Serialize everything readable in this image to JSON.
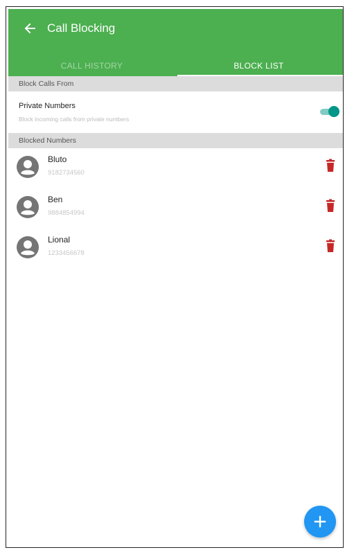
{
  "appbar": {
    "title": "Call Blocking",
    "back_icon": "arrow-left-icon",
    "color": "#4caf50"
  },
  "tabs": [
    {
      "label": "CALL HISTORY",
      "selected": false
    },
    {
      "label": "BLOCK LIST",
      "selected": true
    }
  ],
  "block_calls_from": {
    "header": "Block Calls From",
    "private_numbers": {
      "title": "Private Numbers",
      "subtitle": "Block incoming calls from private numbers",
      "enabled": true,
      "accent": "#009688"
    }
  },
  "blocked_numbers": {
    "header": "Blocked Numbers",
    "items": [
      {
        "name": "Bluto",
        "number": "9182734560"
      },
      {
        "name": "Ben",
        "number": "9884854994"
      },
      {
        "name": "Lional",
        "number": "1233456678"
      }
    ],
    "delete_color": "#c62828"
  },
  "fab": {
    "icon": "plus-icon",
    "color": "#2196f3"
  }
}
